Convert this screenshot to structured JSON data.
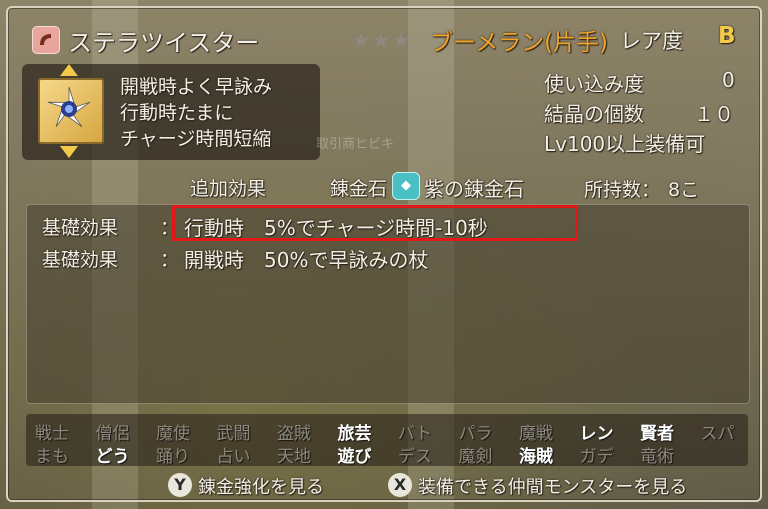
{
  "item": {
    "name": "ステラツイスター",
    "stars": "★★★",
    "type": "ブーメラン(片手)",
    "rarity_label": "レア度",
    "rarity_value": "B",
    "description": [
      "開戦時よく早詠み",
      "行動時たまに",
      "チャージ時間短縮"
    ],
    "watermark": "取引商ヒビキ"
  },
  "stats": {
    "usage_label": "使い込み度",
    "usage_value": "0",
    "crystal_label": "結晶の個数",
    "crystal_value": "１０",
    "equip_requirement": "Lv100以上装備可"
  },
  "tabs": {
    "additional_effect": "追加効果",
    "alchemy_stone_label": "錬金石",
    "alchemy_stone_name": "紫の錬金石",
    "owned_label": "所持数：",
    "owned_value": "8こ"
  },
  "effects": [
    {
      "label": "基礎効果",
      "sep": "：",
      "text": "行動時　5%でチャージ時間-10秒"
    },
    {
      "label": "基礎効果",
      "sep": "：",
      "text": "開戦時　50%で早詠みの杖"
    }
  ],
  "jobs": {
    "row1": [
      {
        "name": "戦士",
        "enabled": false
      },
      {
        "name": "僧侶",
        "enabled": false
      },
      {
        "name": "魔使",
        "enabled": false
      },
      {
        "name": "武闘",
        "enabled": false
      },
      {
        "name": "盗賊",
        "enabled": false
      },
      {
        "name": "旅芸",
        "enabled": true
      },
      {
        "name": "バト",
        "enabled": false
      },
      {
        "name": "パラ",
        "enabled": false
      },
      {
        "name": "魔戦",
        "enabled": false
      },
      {
        "name": "レン",
        "enabled": true
      },
      {
        "name": "賢者",
        "enabled": true
      },
      {
        "name": "スパ",
        "enabled": false
      }
    ],
    "row2": [
      {
        "name": "まも",
        "enabled": false
      },
      {
        "name": "どう",
        "enabled": true
      },
      {
        "name": "踊り",
        "enabled": false
      },
      {
        "name": "占い",
        "enabled": false
      },
      {
        "name": "天地",
        "enabled": false
      },
      {
        "name": "遊び",
        "enabled": true
      },
      {
        "name": "デス",
        "enabled": false
      },
      {
        "name": "魔剣",
        "enabled": false
      },
      {
        "name": "海賊",
        "enabled": true
      },
      {
        "name": "ガデ",
        "enabled": false
      },
      {
        "name": "竜術",
        "enabled": false
      }
    ]
  },
  "buttons": {
    "y_key": "Y",
    "y_label": "錬金強化を見る",
    "x_key": "X",
    "x_label": "装備できる仲間モンスターを見る"
  },
  "colors": {
    "accent_orange": "#f2a22a",
    "rarity_yellow": "#f3c94a",
    "highlight_red": "#e01818",
    "job_enabled": "#ffffff",
    "job_disabled": "#8e887c"
  }
}
